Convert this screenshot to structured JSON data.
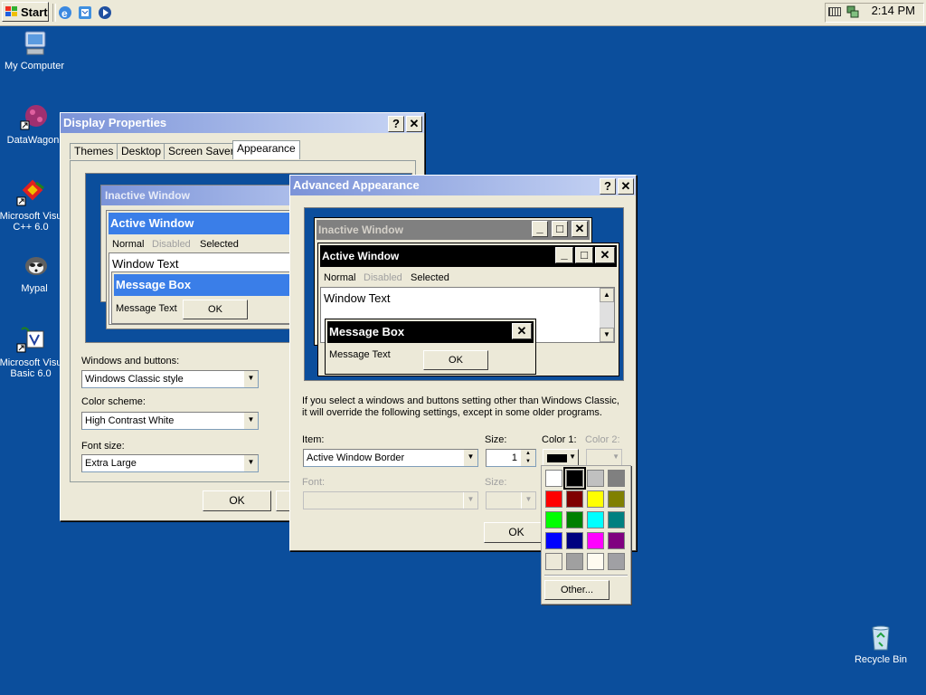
{
  "taskbar": {
    "start_label": "Start",
    "clock": "2:14 PM",
    "quick_launch": [
      "internet-explorer-icon",
      "outlook-express-icon",
      "windows-media-player-icon"
    ]
  },
  "desktop": {
    "icons": [
      {
        "label": "My Computer"
      },
      {
        "label": "DataWagon."
      },
      {
        "label": "Microsoft Visu C++ 6.0"
      },
      {
        "label": "Mypal"
      },
      {
        "label": "Microsoft Visu Basic 6.0"
      },
      {
        "label": "Recycle Bin"
      }
    ]
  },
  "display_properties": {
    "title": "Display Properties",
    "help_btn": "?",
    "close_btn": "✕",
    "tabs": [
      "Themes",
      "Desktop",
      "Screen Saver",
      "Appearance"
    ],
    "preview": {
      "inactive_title": "Inactive Window",
      "active_title": "Active Window",
      "menu_normal": "Normal",
      "menu_disabled": "Disabled",
      "menu_selected": "Selected",
      "window_text": "Window Text",
      "message_box_title": "Message Box",
      "message_text": "Message Text",
      "ok": "OK"
    },
    "windows_buttons_label": "Windows and buttons:",
    "windows_buttons_value": "Windows Classic style",
    "color_scheme_label": "Color scheme:",
    "color_scheme_value": "High Contrast White",
    "font_size_label": "Font size:",
    "font_size_value": "Extra Large",
    "ok_button": "OK"
  },
  "advanced_appearance": {
    "title": "Advanced Appearance",
    "help_btn": "?",
    "close_btn": "✕",
    "preview": {
      "inactive_title": "Inactive Window",
      "active_title": "Active Window",
      "menu_normal": "Normal",
      "menu_disabled": "Disabled",
      "menu_selected": "Selected",
      "window_text": "Window Text",
      "message_box_title": "Message Box",
      "message_text": "Message Text",
      "ok": "OK"
    },
    "info_line1": "If you select a windows and buttons setting other than Windows Classic,",
    "info_line2": "it will override the following settings, except in some older programs.",
    "item_label": "Item:",
    "item_value": "Active Window Border",
    "size_label": "Size:",
    "size_value": "1",
    "color1_label": "Color 1:",
    "color2_label": "Color 2:",
    "font_label": "Font:",
    "font_size_label": "Size:",
    "ok_button": "OK"
  },
  "color_picker": {
    "swatches": [
      "#ffffff",
      "#000000",
      "#c0c0c0",
      "#808080",
      "#ff0000",
      "#800000",
      "#ffff00",
      "#808000",
      "#00ff00",
      "#008000",
      "#00ffff",
      "#008080",
      "#0000ff",
      "#000080",
      "#ff00ff",
      "#800080",
      "#ece9d8",
      "#a0a0a0",
      "#fffbf0",
      "#a0a0a4"
    ],
    "selected_index": 1,
    "other_button": "Other..."
  }
}
